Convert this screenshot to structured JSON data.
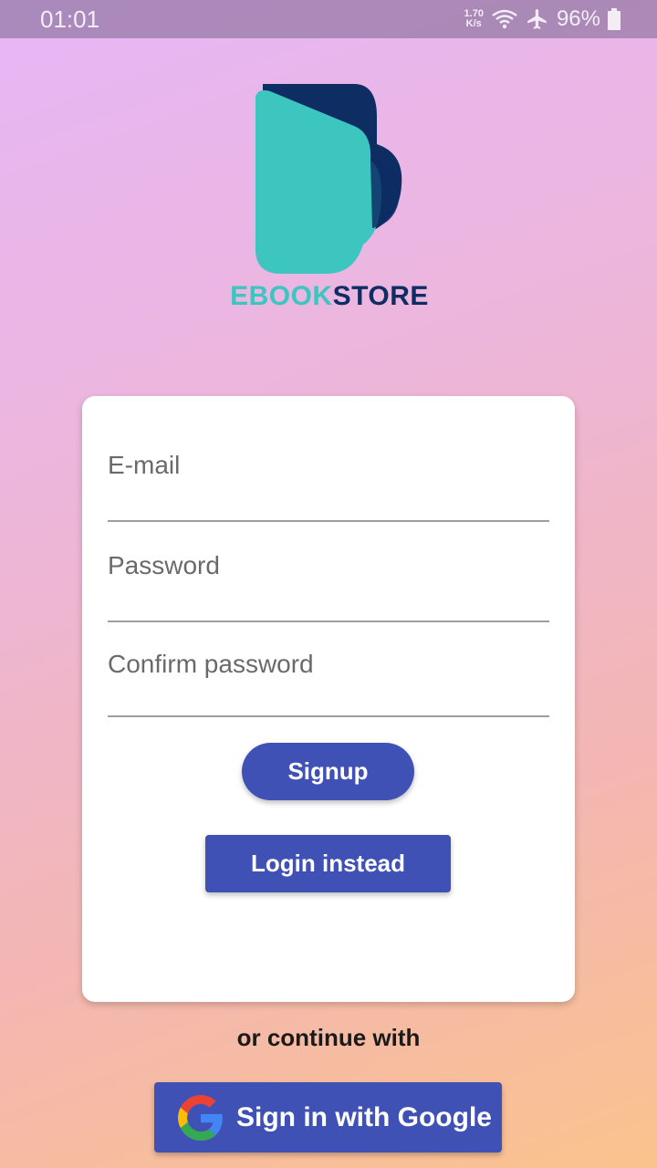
{
  "status_bar": {
    "time": "01:01",
    "net_speed_value": "1.70",
    "net_speed_unit": "K/s",
    "battery": "96%"
  },
  "logo": {
    "text_part1": "EBOOK",
    "text_part2": "STORE"
  },
  "form": {
    "email_placeholder": "E-mail",
    "password_placeholder": "Password",
    "confirm_placeholder": "Confirm password",
    "signup_label": "Signup",
    "login_label": "Login instead"
  },
  "alt_login": {
    "or_text": "or continue with",
    "google_label": "Sign in with Google"
  },
  "colors": {
    "primary": "#3f51b5",
    "logo_teal": "#3cc6bf",
    "logo_navy": "#0d2d63"
  }
}
